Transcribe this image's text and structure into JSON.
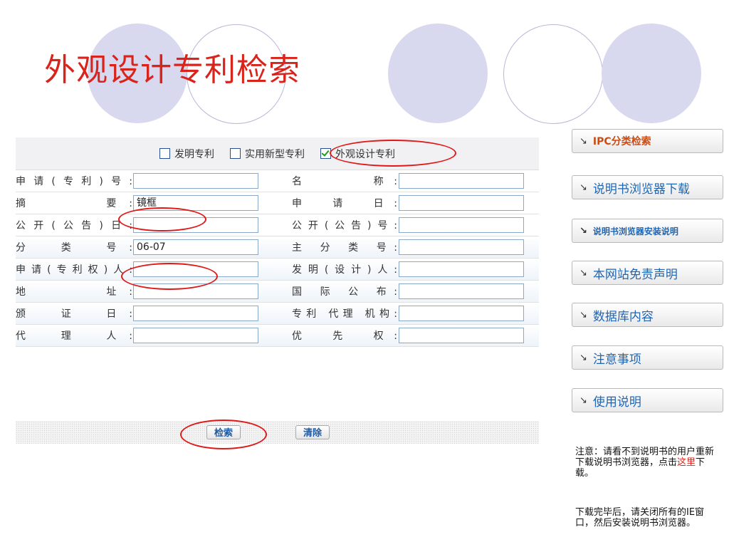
{
  "header": {
    "title": "外观设计专利检索"
  },
  "patent_types": [
    {
      "label": "发明专利",
      "checked": false
    },
    {
      "label": "实用新型专利",
      "checked": false
    },
    {
      "label": "外观设计专利",
      "checked": true
    }
  ],
  "fields": [
    {
      "left_label": "申请(专利)号:",
      "left_value": "",
      "right_label": "名　　　称:",
      "right_value": ""
    },
    {
      "left_label": "摘　　　要:",
      "left_value": "镜框",
      "right_label": "申　请　日:",
      "right_value": ""
    },
    {
      "left_label": "公开(公告)日:",
      "left_value": "",
      "right_label": "公开(公告)号:",
      "right_value": ""
    },
    {
      "left_label": "分　类　号:",
      "left_value": "06-07",
      "right_label": "主 分 类 号:",
      "right_value": ""
    },
    {
      "left_label": "申请(专利权)人:",
      "left_value": "",
      "right_label": "发明(设计)人:",
      "right_value": ""
    },
    {
      "left_label": "地　　　址:",
      "left_value": "",
      "right_label": "国 际 公 布:",
      "right_value": ""
    },
    {
      "left_label": "颁　证　日:",
      "left_value": "",
      "right_label": "专利 代理 机构:",
      "right_value": ""
    },
    {
      "left_label": "代　理　人:",
      "left_value": "",
      "right_label": "优　先　权:",
      "right_value": ""
    }
  ],
  "buttons": {
    "search": "检索",
    "clear": "清除"
  },
  "side_nav": [
    "IPC分类检索",
    "说明书浏览器下载",
    "说明书浏览器安装说明",
    "本网站免责声明",
    "数据库内容",
    "注意事项",
    "使用说明"
  ],
  "side_icon": "arrow-icon",
  "notes": {
    "note1_before": "注意：请看不到说明书的用户重新下载说明书浏览器，点击",
    "note1_link": "这里",
    "note1_after": "下载。",
    "note2": "下载完毕后，请关闭所有的IE窗口，然后安装说明书浏览器。"
  },
  "colors": {
    "title": "#d9241c",
    "highlight": "#e01818",
    "circle": "#d8d8ee",
    "link": "#1f66b5"
  }
}
